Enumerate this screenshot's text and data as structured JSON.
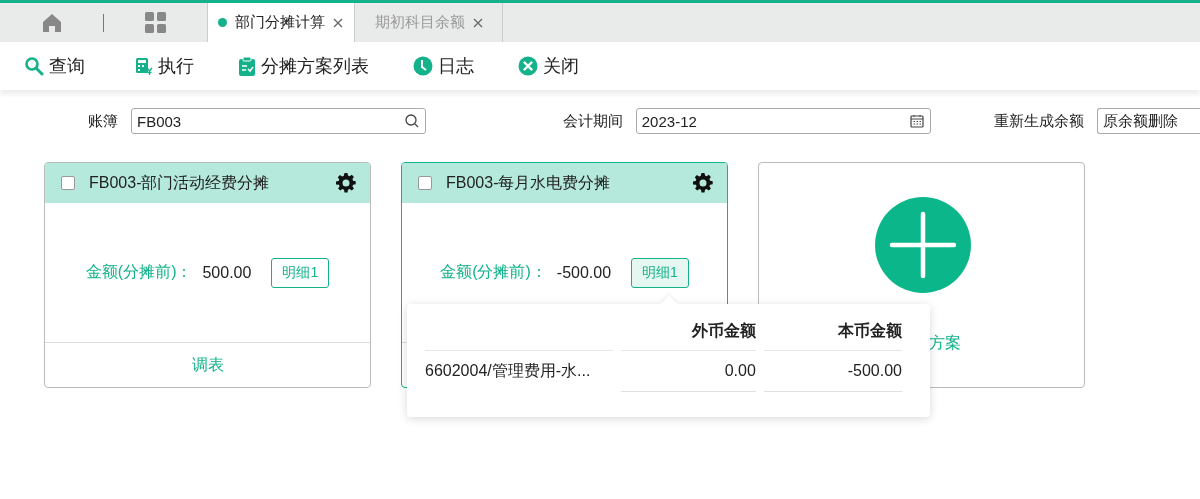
{
  "tabs": [
    {
      "label": "部门分摊计算",
      "selected": true
    },
    {
      "label": "期初科目余额",
      "selected": false
    }
  ],
  "toolbar": [
    {
      "kind": "search",
      "label": "查询"
    },
    {
      "kind": "calc",
      "label": "执行"
    },
    {
      "kind": "clipboard",
      "label": "分摊方案列表"
    },
    {
      "kind": "clock",
      "label": "日志"
    },
    {
      "kind": "close",
      "label": "关闭"
    }
  ],
  "filters": [
    {
      "kind": "lookup",
      "label": "账簿",
      "value": "FB003"
    },
    {
      "kind": "date",
      "label": "会计期间",
      "value": "2023-12"
    },
    {
      "kind": "select",
      "label": "重新生成余额",
      "value": "原余额删除"
    }
  ],
  "cards": [
    {
      "title": "FB003-部门活动经费分摊",
      "checked": false,
      "selected": false,
      "amount_label": "金额(分摊前)：",
      "amount": "500.00",
      "detail_button": {
        "label": "明细1",
        "selected": false
      },
      "footer": "调表"
    },
    {
      "title": "FB003-每月水电费分摊",
      "checked": false,
      "selected": true,
      "amount_label": "金额(分摊前)：",
      "amount": "-500.00",
      "detail_button": {
        "label": "明细1",
        "selected": true
      }
    }
  ],
  "add_card": {
    "label": "方案"
  },
  "detail_popup": {
    "columns": [
      "外币金额",
      "本币金额"
    ],
    "rows": [
      {
        "account": "6602004/管理费用-水...",
        "foreign_amount": "0.00",
        "local_amount": "-500.00"
      }
    ]
  }
}
